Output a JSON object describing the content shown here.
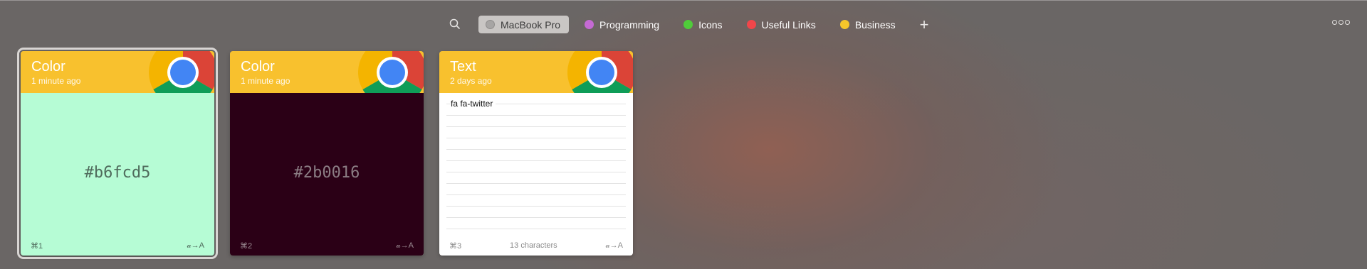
{
  "toolbar": {
    "search_icon": "search-icon",
    "tabs": [
      {
        "label": "MacBook Pro",
        "color": "#a7a5a4",
        "active": true
      },
      {
        "label": "Programming",
        "color": "#c56ad4",
        "active": false
      },
      {
        "label": "Icons",
        "color": "#4fcc3a",
        "active": false
      },
      {
        "label": "Useful Links",
        "color": "#f1464a",
        "active": false
      },
      {
        "label": "Business",
        "color": "#f6c62b",
        "active": false
      }
    ],
    "add_label": "+",
    "more_icon": "more-icon"
  },
  "cards": [
    {
      "type": "Color",
      "time": "1 minute ago",
      "hex": "#b6fcd5",
      "bg": "#b6fcd5",
      "text_color": "#4f6b5c",
      "footer_color": "#4f6b5c",
      "shortcut": "⌘1",
      "format_icon": "𝒶→A"
    },
    {
      "type": "Color",
      "time": "1 minute ago",
      "hex": "#2b0016",
      "bg": "#2b0016",
      "text_color": "#8b7d84",
      "footer_color": "#9c8d94",
      "shortcut": "⌘2",
      "format_icon": "𝒶→A"
    },
    {
      "type": "Text",
      "time": "2 days ago",
      "content": "fa fa-twitter",
      "shortcut": "⌘3",
      "characters": "13 characters",
      "format_icon": "𝒶→A"
    }
  ]
}
